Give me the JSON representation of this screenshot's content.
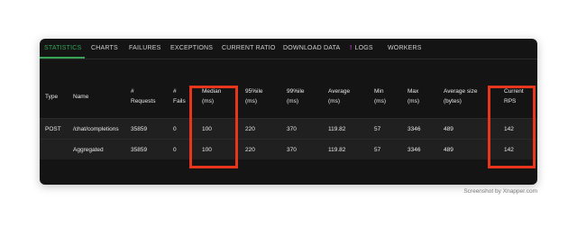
{
  "tabs": [
    {
      "label": "STATISTICS",
      "active": true
    },
    {
      "label": "CHARTS"
    },
    {
      "label": "FAILURES"
    },
    {
      "label": "EXCEPTIONS"
    },
    {
      "label": "CURRENT RATIO"
    },
    {
      "label": "DOWNLOAD DATA"
    },
    {
      "label": "LOGS",
      "icon": "exclamation-icon"
    },
    {
      "label": "WORKERS"
    }
  ],
  "accent_color": "#33a555",
  "highlight_color": "#e8361d",
  "table": {
    "headers": [
      {
        "l1": "Type"
      },
      {
        "l1": "Name"
      },
      {
        "l1": "#",
        "l2": "Requests"
      },
      {
        "l1": "#",
        "l2": "Fails"
      },
      {
        "l1": "Median",
        "l2": "(ms)"
      },
      {
        "l1": "95%ile",
        "l2": "(ms)"
      },
      {
        "l1": "99%ile",
        "l2": "(ms)"
      },
      {
        "l1": "Average",
        "l2": "(ms)"
      },
      {
        "l1": "Min",
        "l2": "(ms)"
      },
      {
        "l1": "Max",
        "l2": "(ms)"
      },
      {
        "l1": "Average size",
        "l2": "(bytes)"
      },
      {
        "l1": "Current",
        "l2": "RPS"
      }
    ],
    "rows": [
      [
        "POST",
        "/chat/completions",
        "35859",
        "0",
        "100",
        "220",
        "370",
        "119.82",
        "57",
        "3346",
        "489",
        "142"
      ],
      [
        "",
        "Aggregated",
        "35859",
        "0",
        "100",
        "220",
        "370",
        "119.82",
        "57",
        "3346",
        "489",
        "142"
      ]
    ]
  },
  "watermark": "Screenshot by Xnapper.com"
}
